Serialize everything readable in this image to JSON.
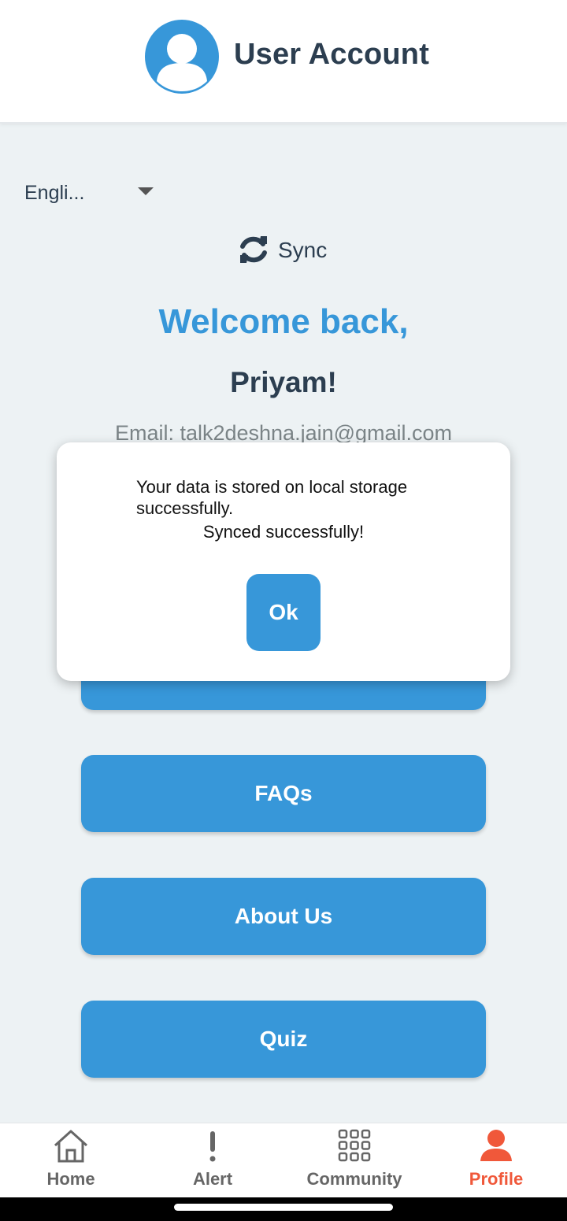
{
  "header": {
    "title": "User Account",
    "icon": "user-circle-icon"
  },
  "language": {
    "selected": "Engli..."
  },
  "sync": {
    "label": "Sync",
    "icon": "sync-icon"
  },
  "welcome": {
    "greeting": "Welcome back,",
    "name": "Priyam!",
    "email": "Email: talk2deshna.jain@gmail.com"
  },
  "buttons": {
    "faqs": "FAQs",
    "about": "About Us",
    "quiz": "Quiz"
  },
  "dialog": {
    "message": "Your data is stored on local storage successfully.",
    "message2": "Synced successfully!",
    "ok": "Ok"
  },
  "nav": {
    "items": [
      {
        "label": "Home",
        "icon": "home-icon"
      },
      {
        "label": "Alert",
        "icon": "alert-icon"
      },
      {
        "label": "Community",
        "icon": "grid-icon"
      },
      {
        "label": "Profile",
        "icon": "profile-icon"
      }
    ],
    "active": "Profile"
  },
  "colors": {
    "accent": "#3797d9",
    "active_nav": "#f0583a",
    "background": "#edf2f4",
    "title": "#2c3e50"
  }
}
